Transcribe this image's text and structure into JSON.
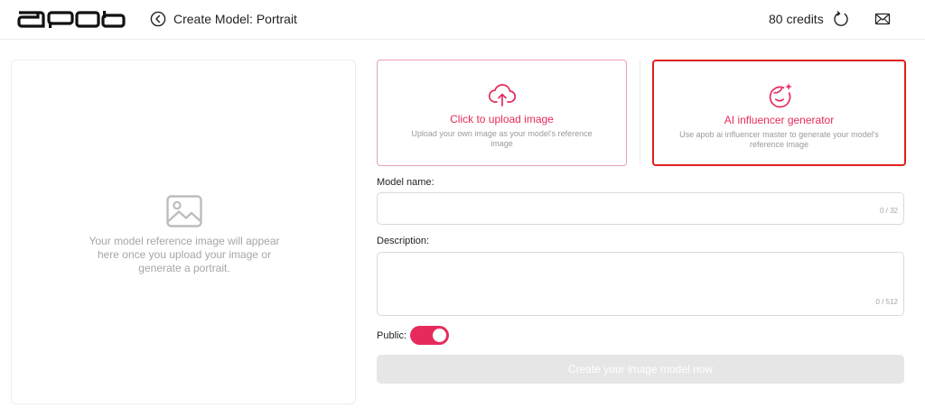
{
  "header": {
    "logo_text": "apob",
    "back_icon": "chevron-left-circle-icon",
    "title": "Create Model: Portrait",
    "credits": "80 credits",
    "refresh_icon": "refresh-icon",
    "mail_icon": "mail-icon"
  },
  "preview": {
    "icon": "image-placeholder-icon",
    "text": "Your model reference image will appear here once you upload your image or generate a portrait."
  },
  "options": {
    "upload": {
      "icon": "cloud-upload-icon",
      "title": "Click to upload image",
      "description": "Upload your own image as your model's reference image"
    },
    "ai": {
      "icon": "face-sparkle-icon",
      "title": "AI influencer generator",
      "description": "Use apob ai influencer master to generate your model's reference image"
    }
  },
  "form": {
    "model_name_label": "Model name:",
    "model_name_value": "",
    "model_name_counter": "0 / 32",
    "description_label": "Description:",
    "description_value": "",
    "description_counter": "0 / 512",
    "public_label": "Public:",
    "public_enabled": true,
    "submit_label": "Create your image model now"
  },
  "colors": {
    "accent": "#e62b5c",
    "highlight_border": "#e0201c",
    "disabled_button": "#e6e6e6"
  }
}
